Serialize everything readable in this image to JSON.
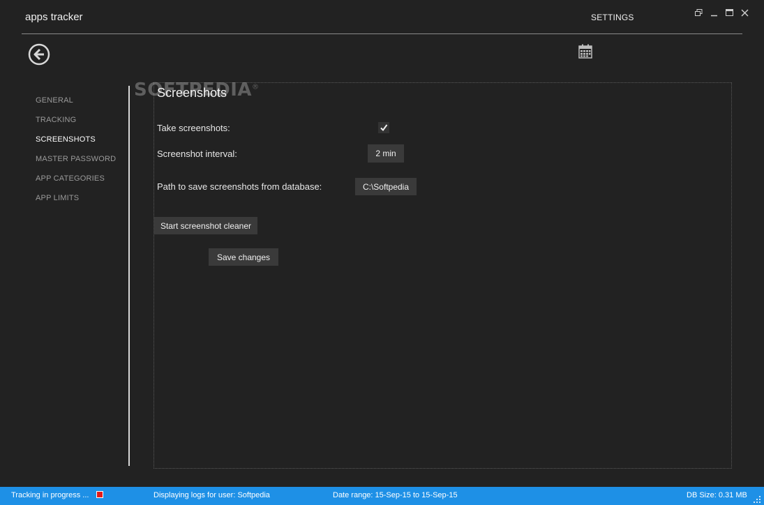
{
  "app": {
    "title": "apps tracker"
  },
  "header": {
    "page_title": "SETTINGS"
  },
  "icons": {
    "back": "back-arrow-circle-icon",
    "calendar": "calendar-icon",
    "restore": "restore-window-icon",
    "minimize": "minimize-icon",
    "maximize": "maximize-icon",
    "close": "close-icon",
    "checkmark": "checkmark-icon"
  },
  "sidebar": {
    "items": [
      {
        "label": "GENERAL"
      },
      {
        "label": "TRACKING"
      },
      {
        "label": "SCREENSHOTS"
      },
      {
        "label": "MASTER PASSWORD"
      },
      {
        "label": "APP CATEGORIES"
      },
      {
        "label": "APP LIMITS"
      }
    ],
    "active_index": 2
  },
  "panel": {
    "title": "Screenshots",
    "take_screenshots": {
      "label": "Take screenshots:",
      "checked": true
    },
    "interval": {
      "label": "Screenshot interval:",
      "value": "2 min"
    },
    "path": {
      "label": "Path to save screenshots from database:",
      "value": "C:\\Softpedia"
    },
    "cleaner_button": "Start screenshot cleaner",
    "save_button": "Save changes"
  },
  "watermark": {
    "text": "SOFTPEDIA",
    "mark": "®"
  },
  "statusbar": {
    "tracking": "Tracking in progress ...",
    "user": "Displaying logs for user: Softpedia",
    "date_range": "Date range: 15-Sep-15 to 15-Sep-15",
    "db_size": "DB Size: 0.31 MB"
  },
  "colors": {
    "background": "#222222",
    "statusbar": "#1e90e6",
    "stop_indicator": "#e21b1b",
    "button": "#3a3a3a"
  }
}
